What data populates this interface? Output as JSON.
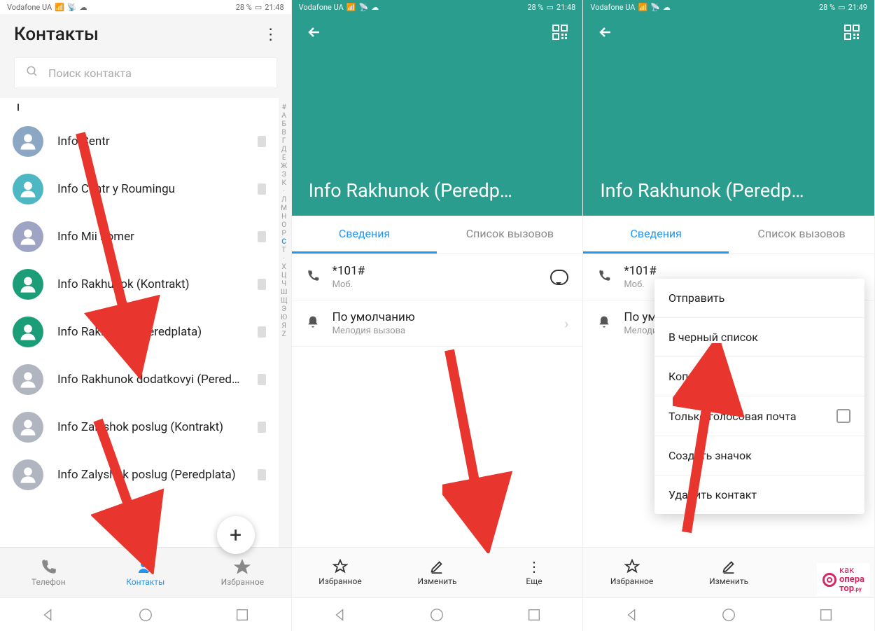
{
  "status": {
    "carrier": "Vodafone UA",
    "battery": "28 %",
    "time1": "21:48",
    "time3": "21:49"
  },
  "screen1": {
    "title": "Контакты",
    "search_placeholder": "Поиск контакта",
    "section": "I",
    "contacts": [
      {
        "name": "Info Centr",
        "color": "#8ca7c4"
      },
      {
        "name": "Info Centr y Roumingu",
        "color": "#4db8c4"
      },
      {
        "name": "Info Mii nomer",
        "color": "#a0a4c4"
      },
      {
        "name": "Info Rakhunok (Kontrakt)",
        "color": "#1b9e77"
      },
      {
        "name": "Info Rakhunok (Peredplata)",
        "color": "#1b9e77"
      },
      {
        "name": "Info Rakhunok dodatkovyi (Peredp…",
        "color": "#b0b5c0"
      },
      {
        "name": "Info Zalyshok poslug (Kontrakt)",
        "color": "#b0b5c0"
      },
      {
        "name": "Info Zalyshok poslug (Peredplata)",
        "color": "#b0b5c0"
      }
    ],
    "alpha": [
      "#",
      "А",
      "Б",
      "В",
      "Г",
      "Д",
      "Е",
      "Ж",
      "З",
      "К",
      "·",
      "Л",
      "М",
      "Н",
      "О",
      "Р",
      "С",
      "Т",
      "·",
      "Х",
      "Ц",
      "Ч",
      "Ш",
      "Щ",
      "Э",
      "Ю",
      "Я",
      "Z"
    ],
    "alpha_active": "С",
    "tabs": {
      "phone": "Телефон",
      "contacts": "Контакты",
      "fav": "Избранное"
    }
  },
  "detail": {
    "name": "Info Rakhunok (Peredp…",
    "tab1": "Сведения",
    "tab2": "Список вызовов",
    "phone": "*101#",
    "phone_label": "Моб.",
    "ringtone": "По умолчанию",
    "ringtone_label": "Мелодия вызова",
    "actions": {
      "fav": "Избранное",
      "edit": "Изменить",
      "more": "Еще"
    }
  },
  "popup": {
    "send": "Отправить",
    "blacklist": "В черный список",
    "copy": "Копировать",
    "voicemail": "Только голосовая почта",
    "shortcut": "Создать значок",
    "delete": "Удалить контакт"
  },
  "watermark": {
    "l1": "как",
    "l2": "опера",
    "l3": "тор"
  }
}
